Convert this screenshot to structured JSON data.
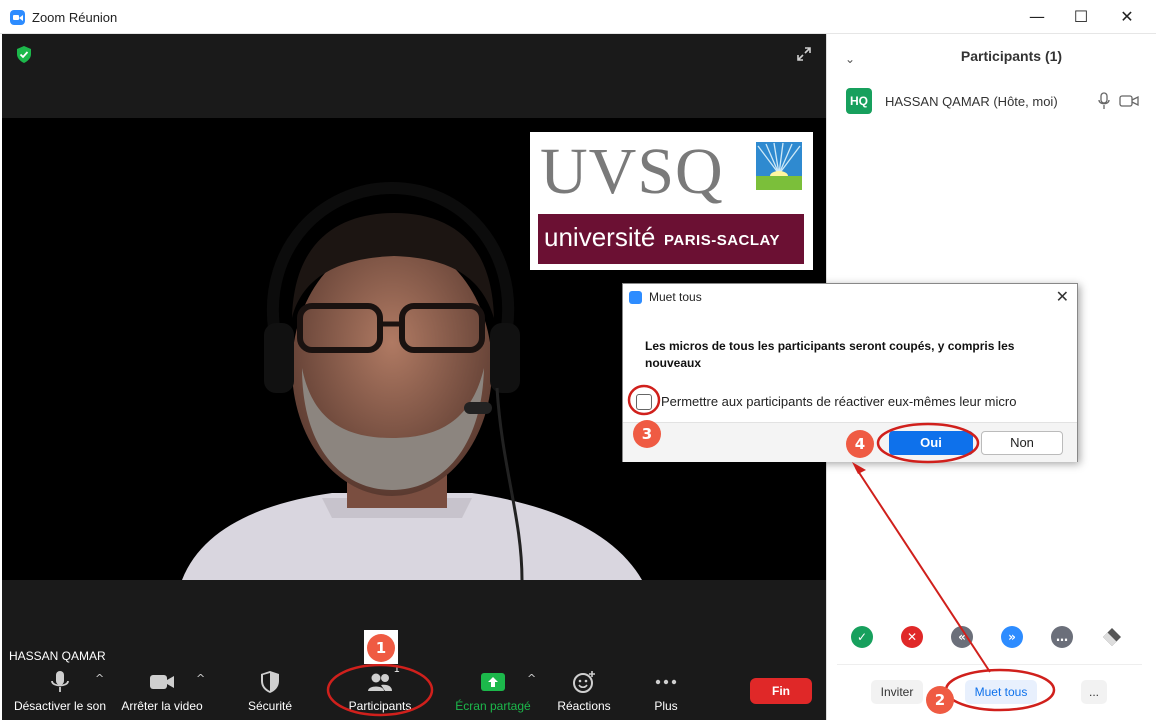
{
  "window": {
    "title": "Zoom Réunion",
    "minimize": "—",
    "maximize": "☐",
    "close": "✕"
  },
  "video": {
    "participant_name_tag": "HASSAN QAMAR",
    "logos": {
      "uvsq": "UVSQ",
      "university_line": "université",
      "university_sub": "PARIS-SACLAY"
    }
  },
  "toolbar": {
    "mute_label": "Désactiver le son",
    "video_label": "Arrêter la video",
    "security_label": "Sécurité",
    "participants_label": "Participants",
    "participants_count": "1",
    "share_label": "Écran partagé",
    "reactions_label": "Réactions",
    "more_label": "Plus",
    "end_label": "Fin",
    "caret": "^"
  },
  "panel": {
    "collapse_glyph": "⌄",
    "title": "Participants (1)",
    "participants": [
      {
        "initials": "HQ",
        "name": "HASSAN QAMAR (Hôte, moi)",
        "avatar_color": "#17a05d"
      }
    ],
    "reaction_colors": [
      "#17a05d",
      "#e02828",
      "#6b6f7a",
      "#2d8cff",
      "#6b6f7a",
      "#555555"
    ],
    "invite_label": "Inviter",
    "mute_all_label": "Muet tous",
    "more_label": "..."
  },
  "dialog": {
    "title": "Muet tous",
    "close": "✕",
    "message": "Les micros de tous les participants seront coupés, y compris les nouveaux",
    "checkbox_label": "Permettre aux participants de réactiver eux-mêmes leur micro",
    "yes_label": "Oui",
    "no_label": "Non"
  },
  "annotations": {
    "step1": "1",
    "step2": "2",
    "step3": "3",
    "step4": "4",
    "color": "#d0201c"
  },
  "colors": {
    "accent_blue": "#0e71eb",
    "end_red": "#e02828",
    "share_green": "#1cb84b",
    "toolbar_bg": "#1a1a1a"
  }
}
